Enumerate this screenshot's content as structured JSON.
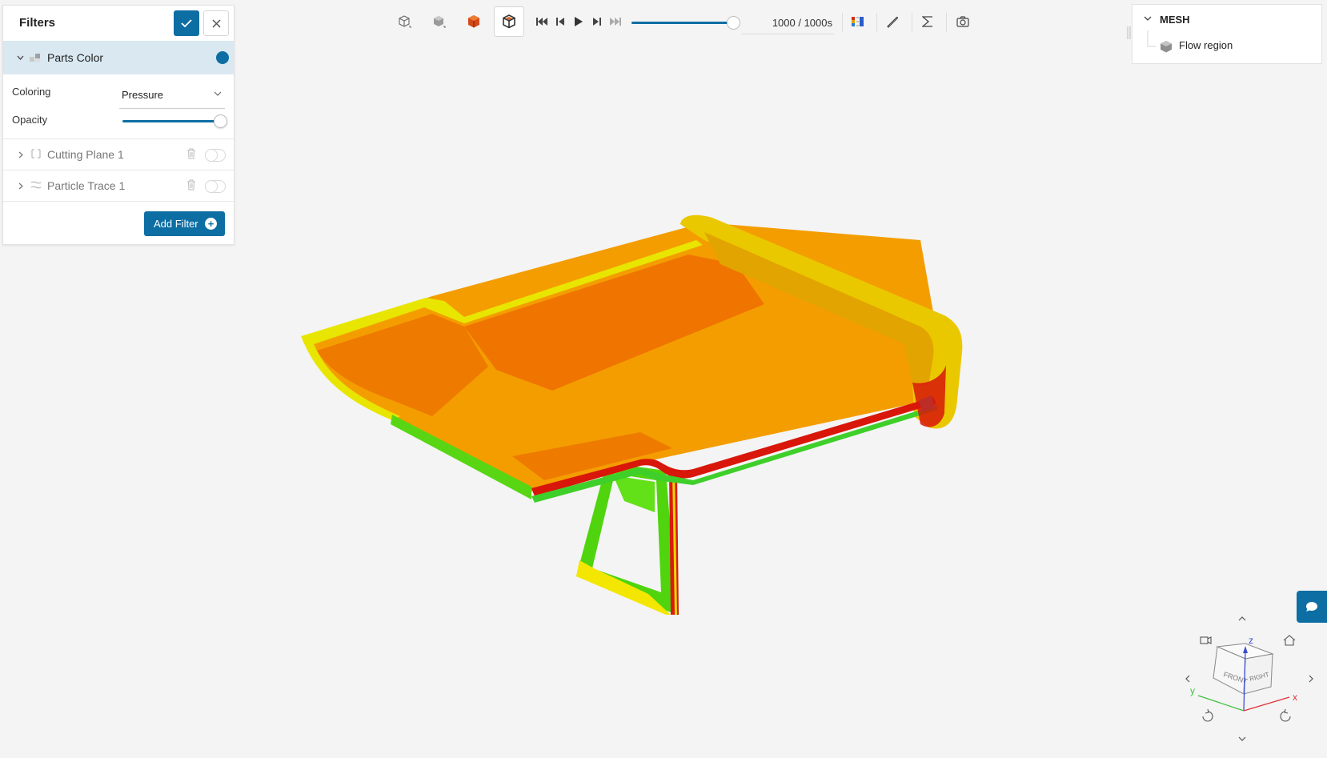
{
  "filters": {
    "title": "Filters",
    "parts_color": {
      "label": "Parts Color",
      "enabled": true,
      "coloring_label": "Coloring",
      "coloring_value": "Pressure",
      "opacity_label": "Opacity",
      "opacity": 1.0
    },
    "items": [
      {
        "label": "Cutting Plane 1",
        "enabled": false,
        "icon": "cutting-plane-icon"
      },
      {
        "label": "Particle Trace 1",
        "enabled": false,
        "icon": "particle-trace-icon"
      }
    ],
    "add_filter_label": "Add Filter"
  },
  "toolbar": {
    "time_label": "1000 / 1000s",
    "time_progress": 1.0,
    "icons": [
      "view-cube-icon",
      "shaded-cube-icon",
      "surface-icon",
      "wireframe-icon",
      "skip-back-icon",
      "step-back-icon",
      "play-icon",
      "step-forward-icon",
      "skip-forward-icon",
      "legend-icon",
      "probe-icon",
      "sigma-icon",
      "camera-icon"
    ]
  },
  "mesh_tree": {
    "title": "MESH",
    "items": [
      {
        "label": "Flow region"
      }
    ]
  },
  "navcube": {
    "front": "FRONT",
    "right": "RIGHT",
    "axes": [
      "x",
      "y",
      "z"
    ]
  },
  "colors": {
    "accent": "#0d6ea3",
    "active_row": "#d9e8f1",
    "background": "#f4f4f4"
  }
}
